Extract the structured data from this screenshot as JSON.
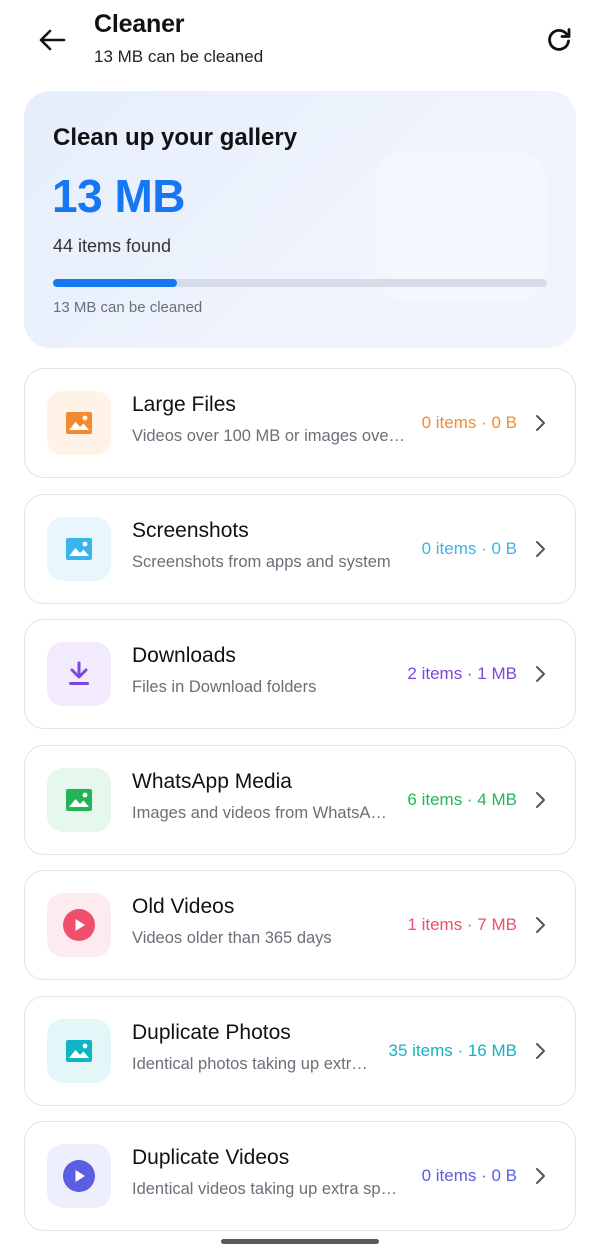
{
  "header": {
    "title": "Cleaner",
    "subtitle": "13 MB can be cleaned"
  },
  "summary": {
    "title": "Clean up your gallery",
    "size": "13 MB",
    "items_found": "44 items found",
    "progress_fraction": 0.25,
    "note": "13 MB can be cleaned",
    "accent_color": "#1677f2"
  },
  "categories": [
    {
      "name": "Large Files",
      "description": "Videos over 100 MB or images ove…",
      "stats": "0 items · 0 B",
      "icon": "image-icon",
      "color": "#f28a33",
      "bg": "#fff2e6"
    },
    {
      "name": "Screenshots",
      "description": "Screenshots from apps and system",
      "stats": "0 items · 0 B",
      "icon": "image-icon",
      "color": "#3bb4ea",
      "bg": "#e8f6fd"
    },
    {
      "name": "Downloads",
      "description": "Files in Download folders",
      "stats": "2 items · 1 MB",
      "icon": "download-icon",
      "color": "#8046dc",
      "bg": "#f1ebfd"
    },
    {
      "name": "WhatsApp Media",
      "description": "Images and videos from WhatsA…",
      "stats": "6 items · 4 MB",
      "icon": "image-icon",
      "color": "#23b45a",
      "bg": "#e6f8ec"
    },
    {
      "name": "Old Videos",
      "description": "Videos older than 365 days",
      "stats": "1 items · 7 MB",
      "icon": "play-icon",
      "color": "#ef4f6b",
      "bg": "#fdecef"
    },
    {
      "name": "Duplicate Photos",
      "description": "Identical photos taking up extr…",
      "stats": "35 items · 16 MB",
      "icon": "image-icon",
      "color": "#12b3c5",
      "bg": "#e3f7f9"
    },
    {
      "name": "Duplicate Videos",
      "description": "Identical videos taking up extra sp…",
      "stats": "0 items · 0 B",
      "icon": "play-icon",
      "color": "#5a5ee0",
      "bg": "#eeeffc"
    }
  ]
}
